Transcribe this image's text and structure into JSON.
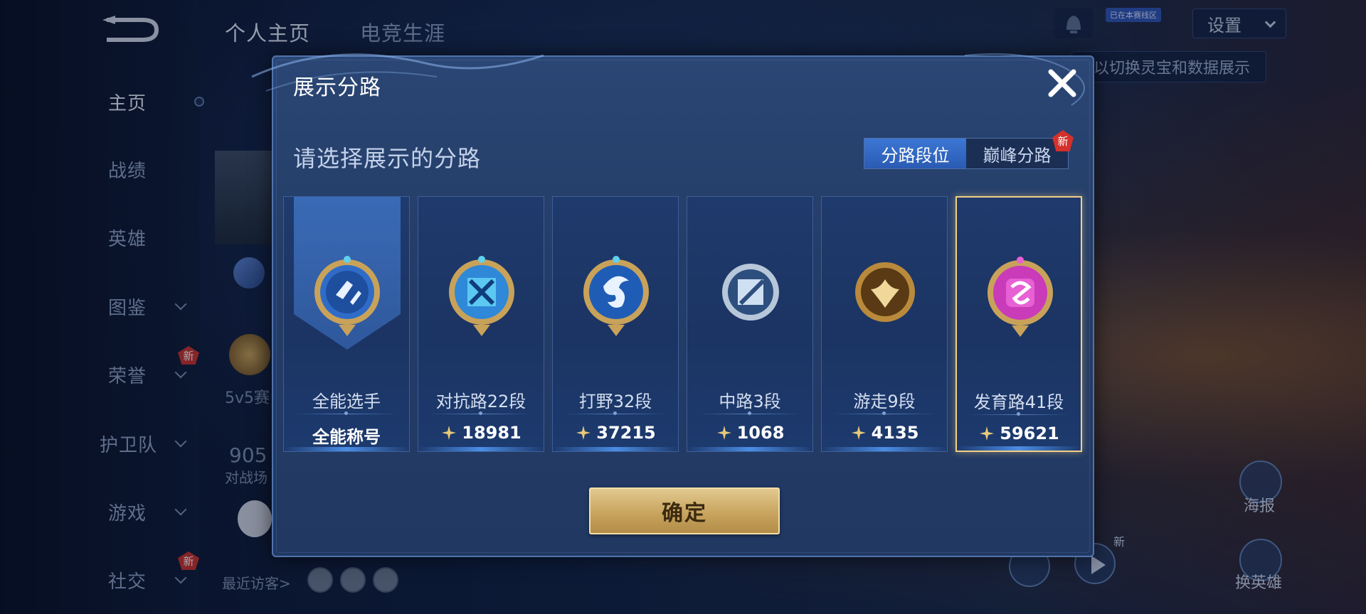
{
  "background": {
    "sidebar": {
      "items": [
        {
          "label": "主页",
          "active": true
        },
        {
          "label": "战绩"
        },
        {
          "label": "英雄"
        },
        {
          "label": "图鉴"
        },
        {
          "label": "荣誉",
          "new": "新"
        },
        {
          "label": "护卫队"
        },
        {
          "label": "游戏"
        },
        {
          "label": "社交",
          "new": "新"
        }
      ]
    },
    "top_tabs": [
      "个人主页",
      "电竞生涯"
    ],
    "settings_label": "设置",
    "hint_text": "以切换灵宝和数据展示",
    "tag_small": "已在本赛线区",
    "profile_texts": [
      "5v5赛",
      "905",
      "对战场"
    ],
    "recent_visitors_label": "最近访客>",
    "right_buttons": [
      {
        "label": "海报",
        "icon": "poster-icon"
      },
      {
        "label": "换英雄",
        "icon": "swap-hero-icon"
      }
    ],
    "play_new_badge": "新"
  },
  "dialog": {
    "title": "展示分路",
    "subtitle": "请选择展示的分路",
    "toggle": {
      "options": [
        "分路段位",
        "巅峰分路"
      ],
      "selected": "分路段位",
      "new_badge": "新"
    },
    "cards": [
      {
        "label": "全能选手",
        "value": "全能称号",
        "icon": "all-round-emblem-icon",
        "color": "#3a7bd5"
      },
      {
        "label": "对抗路22段",
        "value": "18981",
        "icon": "clash-lane-emblem-icon",
        "color": "#3aa6e8"
      },
      {
        "label": "打野32段",
        "value": "37215",
        "icon": "jungle-emblem-icon",
        "color": "#2e6fc4"
      },
      {
        "label": "中路3段",
        "value": "1068",
        "icon": "mid-lane-emblem-icon",
        "color": "#9fb6cf"
      },
      {
        "label": "游走9段",
        "value": "4135",
        "icon": "roam-emblem-icon",
        "color": "#c98d3a"
      },
      {
        "label": "发育路41段",
        "value": "59621",
        "icon": "farm-lane-emblem-icon",
        "color": "#d33fc2",
        "selected": true
      }
    ],
    "confirm_label": "确定"
  },
  "colors": {
    "accent_gold": "#f3cf86",
    "toggle_active": "#2a5bb3",
    "new_badge": "#d5302b"
  }
}
